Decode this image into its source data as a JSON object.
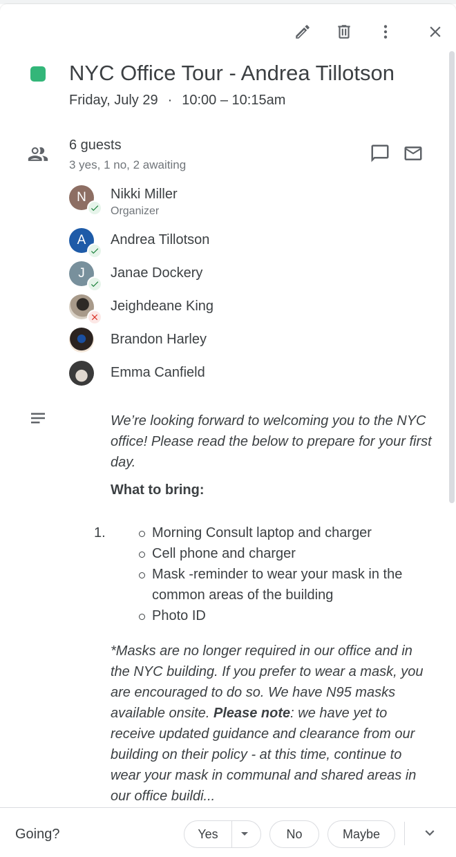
{
  "event": {
    "title": "NYC Office Tour - Andrea Tillotson",
    "date": "Friday, July 29",
    "separator": "·",
    "time": "10:00 – 10:15am",
    "color": "#33b679"
  },
  "toolbar": {
    "edit_icon": "pencil-icon",
    "delete_icon": "trash-icon",
    "more_icon": "more-vert-icon",
    "close_icon": "close-icon"
  },
  "guests": {
    "count_label": "6 guests",
    "summary": "3 yes, 1 no, 2 awaiting",
    "list": [
      {
        "initial": "N",
        "name": "Nikki Miller",
        "role": "Organizer",
        "status": "yes",
        "color": "#8d6e63"
      },
      {
        "initial": "A",
        "name": "Andrea Tillotson",
        "role": "",
        "status": "yes",
        "color": "#1e5ba8"
      },
      {
        "initial": "J",
        "name": "Janae Dockery",
        "role": "",
        "status": "yes",
        "color": "#78909c"
      },
      {
        "initial": "",
        "name": "Jeighdeane King",
        "role": "",
        "status": "no",
        "color": "#6d6258"
      },
      {
        "initial": "",
        "name": "Brandon Harley",
        "role": "",
        "status": "",
        "color": "#2b2320"
      },
      {
        "initial": "",
        "name": "Emma Canfield",
        "role": "",
        "status": "",
        "color": "#4a4a4a"
      }
    ]
  },
  "description": {
    "intro": "We’re looking forward to welcoming you to the NYC office! Please read the below to prepare for your first day.",
    "bring_heading": "What to bring:",
    "list_number": "1.",
    "items": [
      "Morning Consult laptop and charger",
      "Cell phone and charger",
      "Mask -reminder to wear your mask in the common areas of the building",
      "Photo ID"
    ],
    "note_start": "*Masks are no longer required in our office and in the NYC building. If you prefer to wear a mask, you are encouraged to do so. We have N95 masks available onsite. ",
    "note_bold": "Please note",
    "note_end": ": we have yet to receive updated guidance and clearance from our building on their policy - at this time, continue to wear your mask in communal and shared areas in our office buildi..."
  },
  "footer": {
    "going_label": "Going?",
    "yes_label": "Yes",
    "no_label": "No",
    "maybe_label": "Maybe"
  }
}
